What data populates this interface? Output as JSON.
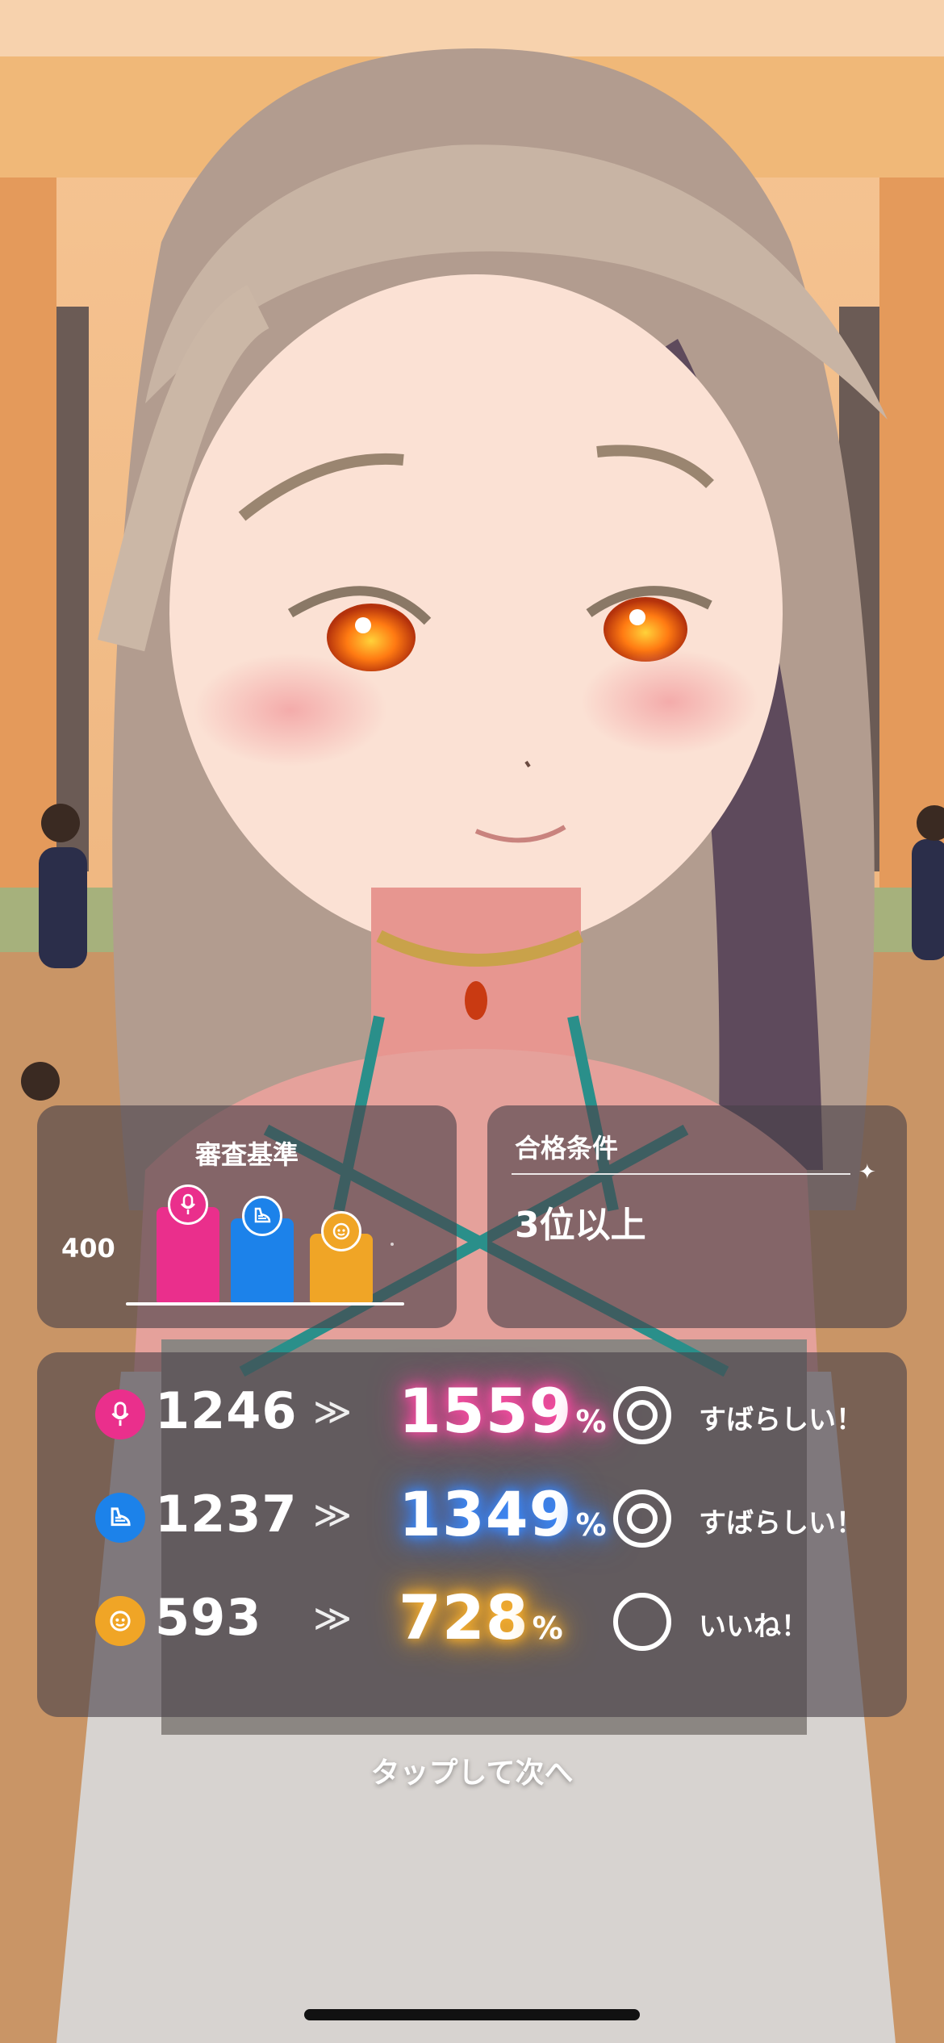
{
  "criteria": {
    "title": "審査基準",
    "axis_value": "400",
    "bars": [
      {
        "name": "vocal",
        "icon": "microphone-icon",
        "color": "#ea2f8c",
        "value": 1000
      },
      {
        "name": "dance",
        "icon": "dance-shoe-icon",
        "color": "#1c82ea",
        "value": 880
      },
      {
        "name": "visual",
        "icon": "visual-face-icon",
        "color": "#f0a526",
        "value": 720
      }
    ]
  },
  "pass_condition": {
    "title": "合格条件",
    "value": "3位以上"
  },
  "stats": [
    {
      "name": "vocal",
      "icon": "microphone-icon",
      "color": "#ea2f8c",
      "before": "1246",
      "after": "1559",
      "unit": "%",
      "grade": "double-circle",
      "rating": "すばらしい！"
    },
    {
      "name": "dance",
      "icon": "dance-shoe-icon",
      "color": "#1c82ea",
      "before": "1237",
      "after": "1349",
      "unit": "%",
      "grade": "double-circle",
      "rating": "すばらしい！"
    },
    {
      "name": "visual",
      "icon": "visual-face-icon",
      "color": "#f0a526",
      "before": "593",
      "after": "728",
      "unit": "%",
      "grade": "circle",
      "rating": "いいね！"
    }
  ],
  "arrows": "≫",
  "tap_prompt": "タップして次へ"
}
